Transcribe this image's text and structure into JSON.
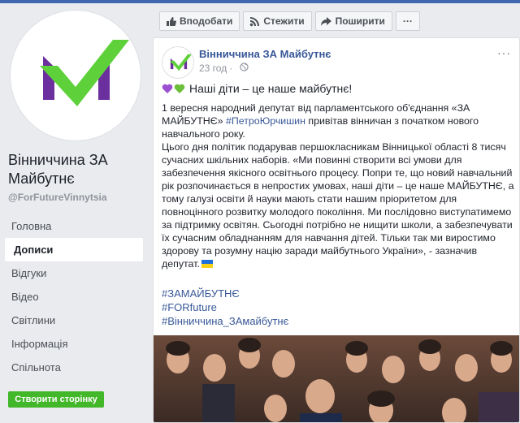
{
  "page": {
    "name": "Вінниччина ЗА Майбутнє",
    "handle": "@ForFutureVinnytsia",
    "create_page_button": "Створити сторінку"
  },
  "nav": {
    "items": [
      {
        "label": "Головна",
        "active": false
      },
      {
        "label": "Дописи",
        "active": true
      },
      {
        "label": "Відгуки",
        "active": false
      },
      {
        "label": "Відео",
        "active": false
      },
      {
        "label": "Світлини",
        "active": false
      },
      {
        "label": "Інформація",
        "active": false
      },
      {
        "label": "Спільнота",
        "active": false
      }
    ]
  },
  "toolbar": {
    "like_label": "Вподобати",
    "follow_label": "Стежити",
    "share_label": "Поширити",
    "more_label": "···"
  },
  "post": {
    "author": "Вінниччина ЗА Майбутнє",
    "time": "23 год",
    "more_label": "···",
    "headline": "Наші діти – це наше майбутнє!",
    "para1_before_tag": "1 вересня народний депутат від парламентського об'єднання «ЗА МАЙБУТНЄ» ",
    "para1_tag": "#ПетроЮрчишин",
    "para1_after_tag": " привітав вінничан з початком нового навчального року.",
    "para2": "Цього дня політик подарував першокласникам Вінницької області 8 тисяч сучасних шкільних наборів. «Ми повинні створити всі умови для забезпечення якісного освітнього процесу. Попри те, що новий навчальний рік розпочинається в непростих умовах, наші діти – це наше МАЙБУТНЄ, а тому галузі освіти й науки мають стати нашим пріоритетом для повноцінного розвитку молодого покоління. Ми послідовно виступатимемо за підтримку освітян. Сьогодні потрібно не нищити школи, а забезпечувати їх сучасним обладнанням для навчання дітей. Тільки так ми виростимо здорову та розумну націю заради майбутнього України», - зазначив депутат.",
    "hashtags": [
      "#ЗАМАЙБУТНЄ",
      "#FORfuture",
      "#Вінниччина_ЗАмайбутнє"
    ]
  },
  "colors": {
    "brand_blue": "#4267b2",
    "link": "#385898",
    "green_button": "#42b72a",
    "logo_green": "#5ed13a",
    "logo_purple": "#6b2f9e"
  }
}
